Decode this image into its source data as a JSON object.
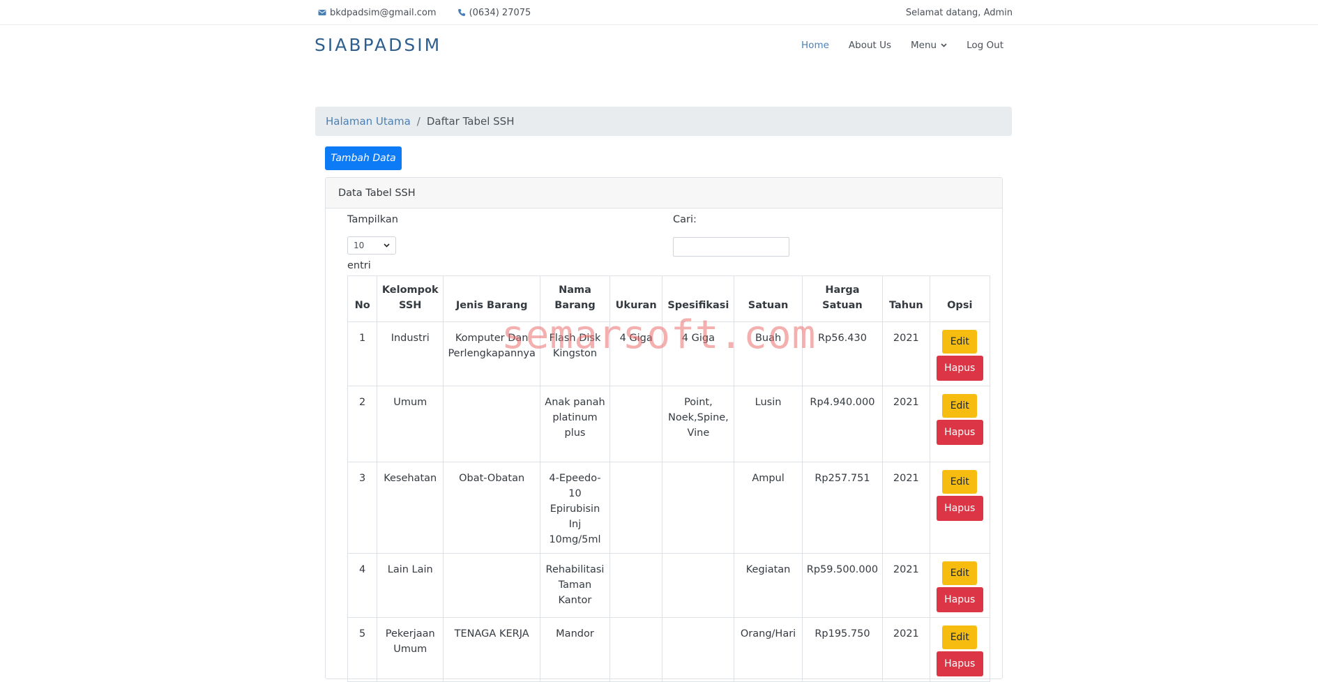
{
  "topbar": {
    "email": "bkdpadsim@gmail.com",
    "phone": "(0634) 27075",
    "welcome": "Selamat datang, Admin"
  },
  "navbar": {
    "brand": "SIABPADSIM",
    "items": [
      {
        "label": "Home",
        "active": true
      },
      {
        "label": "About Us"
      },
      {
        "label": "Menu"
      },
      {
        "label": "Log Out"
      }
    ]
  },
  "breadcrumb": {
    "home": "Halaman Utama",
    "separator": "/",
    "current": "Daftar Tabel SSH"
  },
  "actions": {
    "add_label": "Tambah Data"
  },
  "card": {
    "title": "Data Tabel SSH",
    "show_label": "Tampilkan",
    "show_value": "10",
    "entries_label": "entri",
    "search_label": "Cari:",
    "search_value": ""
  },
  "table": {
    "headers": {
      "no": "No",
      "kelompok": "Kelompok SSH",
      "jenis": "Jenis Barang",
      "nama": "Nama Barang",
      "ukuran": "Ukuran",
      "spesifikasi": "Spesifikasi",
      "satuan": "Satuan",
      "harga": "Harga Satuan",
      "tahun": "Tahun",
      "opsi": "Opsi"
    },
    "rows": [
      {
        "no": "1",
        "kelompok": "Industri",
        "jenis": "Komputer Dan Perlengkapannya",
        "nama": "Flash Disk Kingston",
        "ukuran": "4 Giga",
        "spesifikasi": "4 Giga",
        "satuan": "Buah",
        "harga": "Rp56.430",
        "tahun": "2021"
      },
      {
        "no": "2",
        "kelompok": "Umum",
        "jenis": "",
        "nama": "Anak panah platinum plus",
        "ukuran": "",
        "spesifikasi": "Point, Noek,Spine, Vine",
        "satuan": "Lusin",
        "harga": "Rp4.940.000",
        "tahun": "2021"
      },
      {
        "no": "3",
        "kelompok": "Kesehatan",
        "jenis": "Obat-Obatan",
        "nama": "4-Epeedo-10 Epirubisin Inj 10mg/5ml",
        "ukuran": "",
        "spesifikasi": "",
        "satuan": "Ampul",
        "harga": "Rp257.751",
        "tahun": "2021"
      },
      {
        "no": "4",
        "kelompok": "Lain Lain",
        "jenis": "",
        "nama": "Rehabilitasi Taman Kantor",
        "ukuran": "",
        "spesifikasi": "",
        "satuan": "Kegiatan",
        "harga": "Rp59.500.000",
        "tahun": "2021"
      },
      {
        "no": "5",
        "kelompok": "Pekerjaan Umum",
        "jenis": "TENAGA KERJA",
        "nama": "Mandor",
        "ukuran": "",
        "spesifikasi": "",
        "satuan": "Orang/Hari",
        "harga": "Rp195.750",
        "tahun": "2021"
      }
    ],
    "edit_label": "Edit",
    "delete_label": "Hapus"
  },
  "watermark": "semarsoft.com",
  "colors": {
    "primary": "#0d7bf5",
    "warning": "#f6bd10",
    "danger": "#dc3545",
    "brand": "#2f5f8f"
  }
}
